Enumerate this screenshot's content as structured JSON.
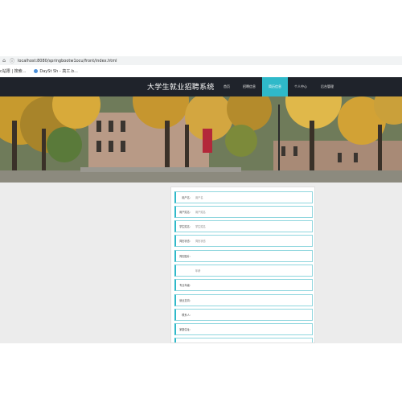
{
  "browser": {
    "home_icon": "home-icon",
    "info_icon": "info-icon",
    "url": "localhost:8080/springbootw1ocu/front/index.html",
    "bookmarks": [
      {
        "label": "c站限 | 搜索..."
      },
      {
        "label": "DaySt Sh - 高工.b..."
      }
    ]
  },
  "header": {
    "title": "大学生就业招聘系统",
    "nav": [
      {
        "label": "首页",
        "active": false
      },
      {
        "label": "招聘信息",
        "active": false
      },
      {
        "label": "简历信息",
        "active": true
      },
      {
        "label": "个人中心",
        "active": false
      },
      {
        "label": "后台管理",
        "active": false
      }
    ]
  },
  "form": {
    "rows": [
      {
        "label": "用户名：",
        "placeholder": "用户名"
      },
      {
        "label": "用户姓名：",
        "placeholder": "用户姓名"
      },
      {
        "label": "学生姓名：",
        "placeholder": "学生姓名"
      },
      {
        "label": "简历状态：",
        "placeholder": "简历状态"
      },
      {
        "label": "简历图片：",
        "placeholder": ""
      },
      {
        "label": "",
        "placeholder": "年龄"
      },
      {
        "label": "专业年级：",
        "placeholder": ""
      },
      {
        "label": "就业意向：",
        "placeholder": ""
      },
      {
        "label": "联系人：",
        "placeholder": ""
      },
      {
        "label": "家庭住址：",
        "placeholder": ""
      },
      {
        "label": "",
        "placeholder": ""
      }
    ]
  },
  "colors": {
    "header_bg": "#1f232b",
    "accent": "#2fb9c9",
    "content_bg": "#ececec"
  }
}
